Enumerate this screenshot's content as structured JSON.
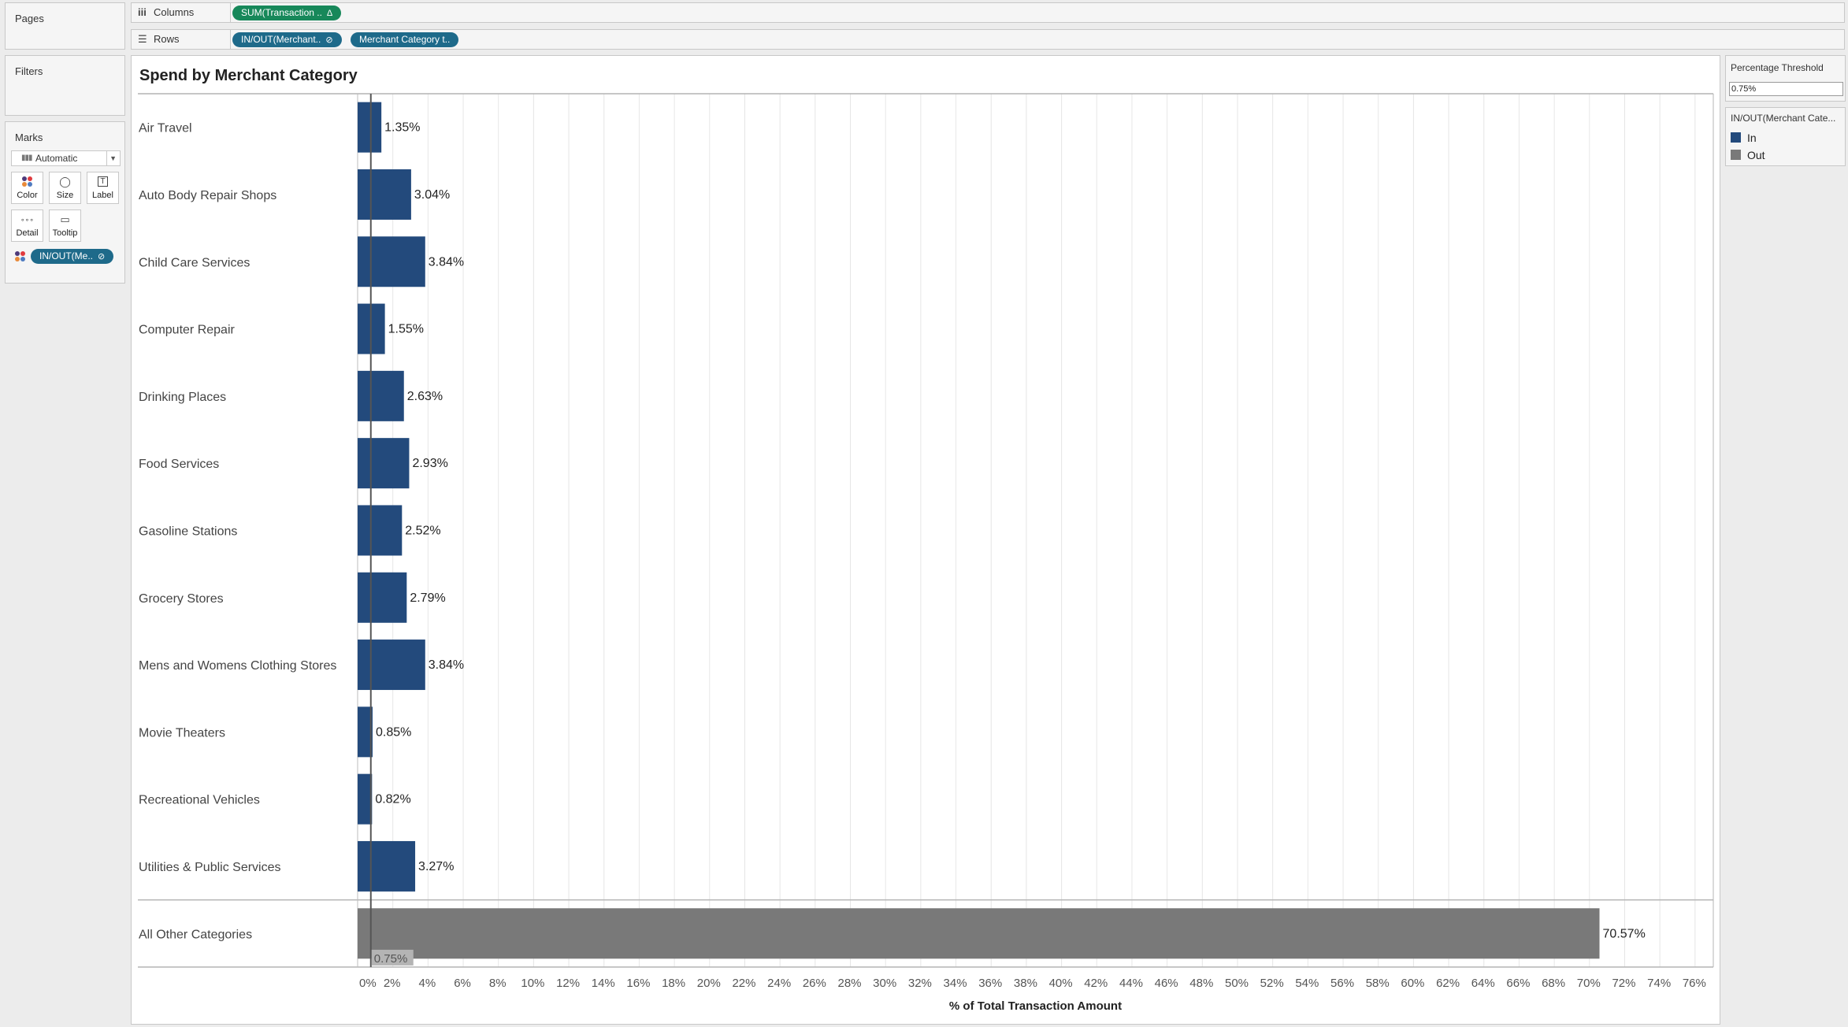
{
  "panels": {
    "pages_label": "Pages",
    "filters_label": "Filters",
    "marks": {
      "title": "Marks",
      "mark_type": "Automatic",
      "buttons": [
        {
          "label": "Color",
          "icon": "color-dots-icon"
        },
        {
          "label": "Size",
          "icon": "size-icon"
        },
        {
          "label": "Label",
          "icon": "label-icon"
        },
        {
          "label": "Detail",
          "icon": "detail-icon"
        },
        {
          "label": "Tooltip",
          "icon": "tooltip-icon"
        }
      ],
      "color_pill": "IN/OUT(Me.."
    }
  },
  "shelves": {
    "columns": {
      "label": "Columns",
      "pills": [
        {
          "text": "SUM(Transaction ..",
          "glyph": "Δ"
        }
      ]
    },
    "rows": {
      "label": "Rows",
      "pills": [
        {
          "text": "IN/OUT(Merchant..",
          "glyph": "⊘"
        },
        {
          "text": "Merchant Category t..",
          "glyph": ""
        }
      ]
    }
  },
  "parameter": {
    "title": "Percentage Threshold",
    "value": "0.75%"
  },
  "legend": {
    "title": "IN/OUT(Merchant Cate...",
    "items": [
      {
        "label": "In",
        "color": "#234a7c"
      },
      {
        "label": "Out",
        "color": "#797979"
      }
    ]
  },
  "chart_data": {
    "type": "bar",
    "orientation": "horizontal",
    "title": "Spend by Merchant Category",
    "xlabel": "% of Total Transaction Amount",
    "ylabel": "",
    "xlim": [
      0,
      77
    ],
    "x_ticks": [
      "0%",
      "2%",
      "4%",
      "6%",
      "8%",
      "10%",
      "12%",
      "14%",
      "16%",
      "18%",
      "20%",
      "22%",
      "24%",
      "26%",
      "28%",
      "30%",
      "32%",
      "34%",
      "36%",
      "38%",
      "40%",
      "42%",
      "44%",
      "46%",
      "48%",
      "50%",
      "52%",
      "54%",
      "56%",
      "58%",
      "60%",
      "62%",
      "64%",
      "66%",
      "68%",
      "70%",
      "72%",
      "74%",
      "76%"
    ],
    "grid": true,
    "legend_position": "right",
    "reference_line": {
      "value": 0.75,
      "label": "0.75%"
    },
    "groups": [
      {
        "name": "In",
        "color": "#234a7c",
        "categories": [
          "Air Travel",
          "Auto Body Repair Shops",
          "Child Care Services",
          "Computer Repair",
          "Drinking Places",
          "Food Services",
          "Gasoline Stations",
          "Grocery Stores",
          "Mens and Womens Clothing Stores",
          "Movie Theaters",
          "Recreational Vehicles",
          "Utilities & Public Services"
        ],
        "values": [
          1.35,
          3.04,
          3.84,
          1.55,
          2.63,
          2.93,
          2.52,
          2.79,
          3.84,
          0.85,
          0.82,
          3.27
        ],
        "labels": [
          "1.35%",
          "3.04%",
          "3.84%",
          "1.55%",
          "2.63%",
          "2.93%",
          "2.52%",
          "2.79%",
          "3.84%",
          "0.85%",
          "0.82%",
          "3.27%"
        ]
      },
      {
        "name": "Out",
        "color": "#797979",
        "categories": [
          "All Other Categories"
        ],
        "values": [
          70.57
        ],
        "labels": [
          "70.57%"
        ]
      }
    ]
  }
}
